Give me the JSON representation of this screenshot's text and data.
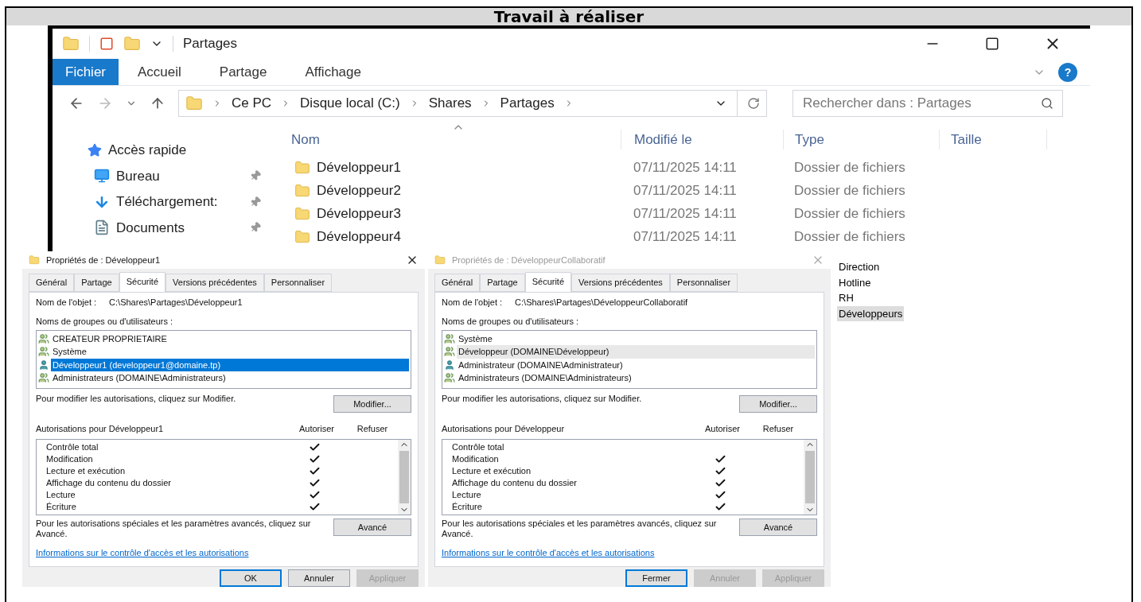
{
  "document": {
    "heading": "Travail à réaliser"
  },
  "explorer": {
    "title": "Partages",
    "ribbon_tabs": [
      {
        "label": "Fichier",
        "selected": true
      },
      {
        "label": "Accueil",
        "selected": false
      },
      {
        "label": "Partage",
        "selected": false
      },
      {
        "label": "Affichage",
        "selected": false
      }
    ],
    "breadcrumb": [
      "Ce PC",
      "Disque local (C:)",
      "Shares",
      "Partages"
    ],
    "search": {
      "placeholder": "Rechercher dans : Partages"
    },
    "help_button": "?",
    "nav_items": [
      {
        "label": "Accès rapide",
        "kind": "star",
        "pinned": false
      },
      {
        "label": "Bureau",
        "kind": "desktop",
        "pinned": true
      },
      {
        "label": "Téléchargement:",
        "kind": "download",
        "pinned": true
      },
      {
        "label": "Documents",
        "kind": "document",
        "pinned": true
      }
    ],
    "columns": [
      "Nom",
      "Modifié le",
      "Type",
      "Taille"
    ],
    "rows": [
      {
        "name": "Développeur1",
        "modified": "07/11/2025 14:11",
        "type": "Dossier de fichiers"
      },
      {
        "name": "Développeur2",
        "modified": "07/11/2025 14:11",
        "type": "Dossier de fichiers"
      },
      {
        "name": "Développeur3",
        "modified": "07/11/2025 14:11",
        "type": "Dossier de fichiers"
      },
      {
        "name": "Développeur4",
        "modified": "07/11/2025 14:11",
        "type": "Dossier de fichiers"
      }
    ]
  },
  "dialogs": [
    {
      "title": "Propriétés de : Développeur1",
      "active": true,
      "tabs": [
        {
          "label": "Général",
          "selected": false
        },
        {
          "label": "Partage",
          "selected": false
        },
        {
          "label": "Sécurité",
          "selected": true
        },
        {
          "label": "Versions précédentes",
          "selected": false
        },
        {
          "label": "Personnaliser",
          "selected": false
        }
      ],
      "object_label": "Nom de l'objet :",
      "object_path": "C:\\Shares\\Partages\\Développeur1",
      "groups_label": "Noms de groupes ou d'utilisateurs :",
      "groups": [
        {
          "name": "CREATEUR PROPRIETAIRE",
          "kind": "group",
          "selected": false
        },
        {
          "name": "Système",
          "kind": "group",
          "selected": false
        },
        {
          "name": "Développeur1 (developpeur1@domaine.tp)",
          "kind": "user",
          "selected": true
        },
        {
          "name": "Administrateurs (DOMAINE\\Administrateurs)",
          "kind": "group",
          "selected": false
        }
      ],
      "modify_hint": "Pour modifier les autorisations, cliquez sur Modifier.",
      "modify_button": "Modifier...",
      "permissions_label": "Autorisations pour Développeur1",
      "allow_heading": "Autoriser",
      "deny_heading": "Refuser",
      "permissions": [
        {
          "name": "Contrôle total",
          "allow": true,
          "deny": false
        },
        {
          "name": "Modification",
          "allow": true,
          "deny": false
        },
        {
          "name": "Lecture et exécution",
          "allow": true,
          "deny": false
        },
        {
          "name": "Affichage du contenu du dossier",
          "allow": true,
          "deny": false
        },
        {
          "name": "Lecture",
          "allow": true,
          "deny": false
        },
        {
          "name": "Écriture",
          "allow": true,
          "deny": false
        }
      ],
      "advanced_hint": "Pour les autorisations spéciales et les paramètres avancés, cliquez sur Avancé.",
      "advanced_button": "Avancé",
      "link": "Informations sur le contrôle d'accès et les autorisations",
      "buttons": [
        {
          "label": "OK",
          "disabled": false
        },
        {
          "label": "Annuler",
          "disabled": false
        },
        {
          "label": "Appliquer",
          "disabled": true
        }
      ]
    },
    {
      "title": "Propriétés de : DéveloppeurCollaboratif",
      "active": false,
      "tabs": [
        {
          "label": "Général",
          "selected": false
        },
        {
          "label": "Partage",
          "selected": false
        },
        {
          "label": "Sécurité",
          "selected": true
        },
        {
          "label": "Versions précédentes",
          "selected": false
        },
        {
          "label": "Personnaliser",
          "selected": false
        }
      ],
      "object_label": "Nom de l'objet :",
      "object_path": "C:\\Shares\\Partages\\DéveloppeurCollaboratif",
      "groups_label": "Noms de groupes ou d'utilisateurs :",
      "groups": [
        {
          "name": "Système",
          "kind": "group",
          "selected": false
        },
        {
          "name": "Développeur (DOMAINE\\Développeur)",
          "kind": "group",
          "selected": true
        },
        {
          "name": "Administrateur (DOMAINE\\Administrateur)",
          "kind": "user",
          "selected": false
        },
        {
          "name": "Administrateurs (DOMAINE\\Administrateurs)",
          "kind": "group",
          "selected": false
        }
      ],
      "modify_hint": "Pour modifier les autorisations, cliquez sur Modifier.",
      "modify_button": "Modifier...",
      "permissions_label": "Autorisations pour Développeur",
      "allow_heading": "Autoriser",
      "deny_heading": "Refuser",
      "permissions": [
        {
          "name": "Contrôle total",
          "allow": false,
          "deny": false
        },
        {
          "name": "Modification",
          "allow": true,
          "deny": false
        },
        {
          "name": "Lecture et exécution",
          "allow": true,
          "deny": false
        },
        {
          "name": "Affichage du contenu du dossier",
          "allow": true,
          "deny": false
        },
        {
          "name": "Lecture",
          "allow": true,
          "deny": false
        },
        {
          "name": "Écriture",
          "allow": true,
          "deny": false
        }
      ],
      "advanced_hint": "Pour les autorisations spéciales et les paramètres avancés, cliquez sur Avancé.",
      "advanced_button": "Avancé",
      "link": "Informations sur le contrôle d'accès et les autorisations",
      "buttons": [
        {
          "label": "Fermer",
          "disabled": false
        },
        {
          "label": "Annuler",
          "disabled": true
        },
        {
          "label": "Appliquer",
          "disabled": true
        }
      ]
    }
  ],
  "side_list": [
    {
      "label": "Direction",
      "selected": false
    },
    {
      "label": "Hotline",
      "selected": false
    },
    {
      "label": "RH",
      "selected": false
    },
    {
      "label": "Développeurs",
      "selected": true
    }
  ]
}
